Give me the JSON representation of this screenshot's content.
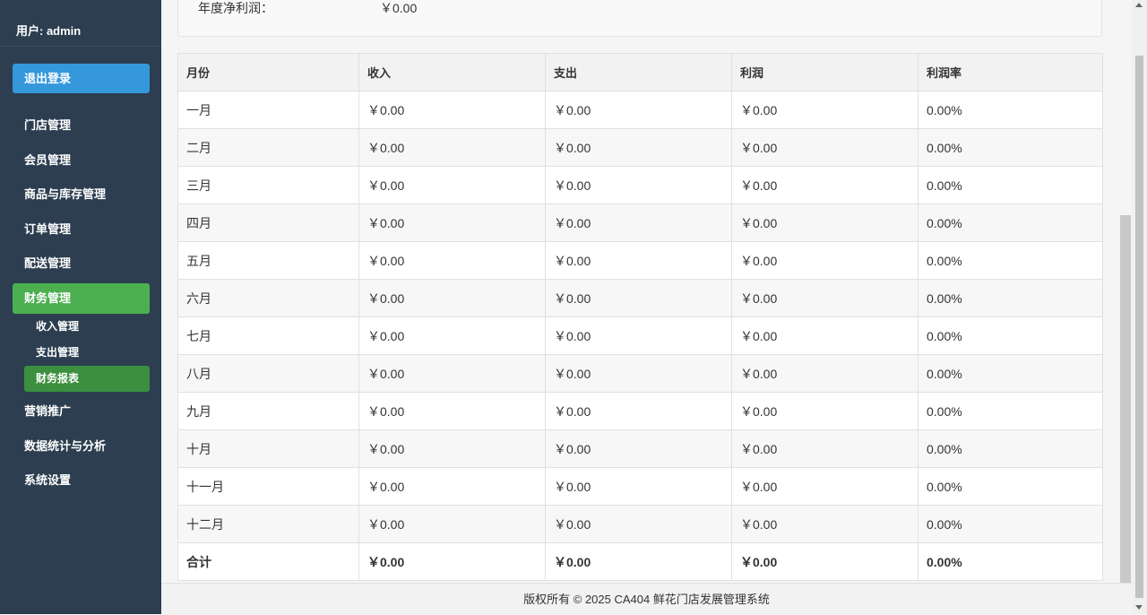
{
  "sidebar": {
    "user_label": "用户: admin",
    "logout_label": "退出登录",
    "items": [
      {
        "label": "门店管理"
      },
      {
        "label": "会员管理"
      },
      {
        "label": "商品与库存管理"
      },
      {
        "label": "订单管理"
      },
      {
        "label": "配送管理"
      },
      {
        "label": "财务管理"
      },
      {
        "label": "营销推广"
      },
      {
        "label": "数据统计与分析"
      },
      {
        "label": "系统设置"
      }
    ],
    "sub_items": [
      {
        "label": "收入管理"
      },
      {
        "label": "支出管理"
      },
      {
        "label": "财务报表"
      }
    ],
    "active_color": "#4caf50",
    "logout_color": "#3498db"
  },
  "summary": {
    "label": "年度净利润：",
    "value": "￥0.00"
  },
  "table": {
    "headers": [
      "月份",
      "收入",
      "支出",
      "利润",
      "利润率"
    ],
    "rows": [
      [
        "一月",
        "￥0.00",
        "￥0.00",
        "￥0.00",
        "0.00%"
      ],
      [
        "二月",
        "￥0.00",
        "￥0.00",
        "￥0.00",
        "0.00%"
      ],
      [
        "三月",
        "￥0.00",
        "￥0.00",
        "￥0.00",
        "0.00%"
      ],
      [
        "四月",
        "￥0.00",
        "￥0.00",
        "￥0.00",
        "0.00%"
      ],
      [
        "五月",
        "￥0.00",
        "￥0.00",
        "￥0.00",
        "0.00%"
      ],
      [
        "六月",
        "￥0.00",
        "￥0.00",
        "￥0.00",
        "0.00%"
      ],
      [
        "七月",
        "￥0.00",
        "￥0.00",
        "￥0.00",
        "0.00%"
      ],
      [
        "八月",
        "￥0.00",
        "￥0.00",
        "￥0.00",
        "0.00%"
      ],
      [
        "九月",
        "￥0.00",
        "￥0.00",
        "￥0.00",
        "0.00%"
      ],
      [
        "十月",
        "￥0.00",
        "￥0.00",
        "￥0.00",
        "0.00%"
      ],
      [
        "十一月",
        "￥0.00",
        "￥0.00",
        "￥0.00",
        "0.00%"
      ],
      [
        "十二月",
        "￥0.00",
        "￥0.00",
        "￥0.00",
        "0.00%"
      ]
    ],
    "total": [
      "合计",
      "￥0.00",
      "￥0.00",
      "￥0.00",
      "0.00%"
    ]
  },
  "footer": {
    "text": "版权所有 © 2025 CA404 鲜花门店发展管理系统"
  }
}
